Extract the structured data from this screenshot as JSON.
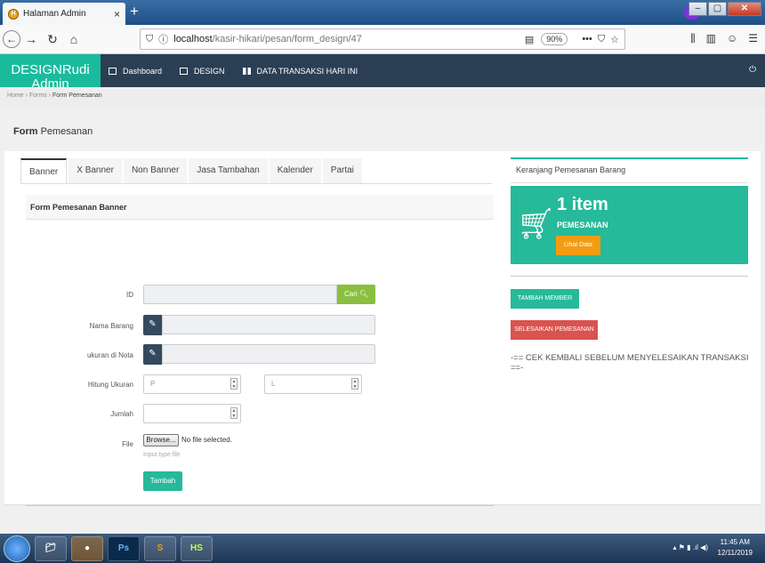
{
  "browser": {
    "tab_title": "Halaman Admin",
    "tab_close": "×",
    "new_tab": "+",
    "url_host": "localhost",
    "url_path": "/kasir-hikari/pesan/form_design/47",
    "zoom": "90%"
  },
  "app": {
    "brand_line1": "DESIGNRudi",
    "brand_line2": "Admin",
    "nav": [
      {
        "label": "Dashboard",
        "icon": "monitor-icon"
      },
      {
        "label": "DESIGN",
        "icon": "image-icon"
      },
      {
        "label": "DATA TRANSAKSI HARI INI",
        "icon": "grid-icon"
      }
    ]
  },
  "breadcrumb": {
    "home": "Home",
    "forms": "Forms",
    "current": "Form Pemesanan",
    "sep": "›"
  },
  "page": {
    "title_bold": "Form",
    "title_rest": "Pemesanan"
  },
  "tabs": [
    "Banner",
    "X Banner",
    "Non Banner",
    "Jasa Tambahan",
    "Kalender",
    "Partai"
  ],
  "form": {
    "heading": "Form Pemesanan Banner",
    "id_label": "ID",
    "cari_button": "Cari",
    "nama_label": "Nama Barang",
    "ukuran_label": "ukuran di Nota",
    "hitung_label": "Hitung Ukuran",
    "p_placeholder": "P",
    "l_placeholder": "L",
    "jumlah_label": "Jumlah",
    "file_label": "File",
    "browse_button": "Browse...",
    "no_file": "No file selected.",
    "help_text": "Input type file",
    "submit_button": "Tambah"
  },
  "cart": {
    "heading": "Keranjang Pemesanan Barang",
    "count": "1 item",
    "sublabel": "PEMESANAN",
    "lihat_button": "Lihat Data",
    "member_button": "TAMBAH MEMBER",
    "finish_button": "SELESAIKAN PEMESANAN",
    "warning": "-== CEK KEMBALI SEBELUM MENYELESAIKAN TRANSAKSI ==-"
  },
  "taskbar": {
    "time": "11:45 AM",
    "date": "12/11/2019",
    "apps": [
      "file-explorer",
      "firefox",
      "Ps",
      "S",
      "HS"
    ]
  },
  "colors": {
    "brand": "#1abb9c",
    "header": "#2a3f54",
    "success": "#26b99a",
    "warning": "#f39c12",
    "danger": "#d9534f",
    "cari": "#8bbf3f"
  }
}
